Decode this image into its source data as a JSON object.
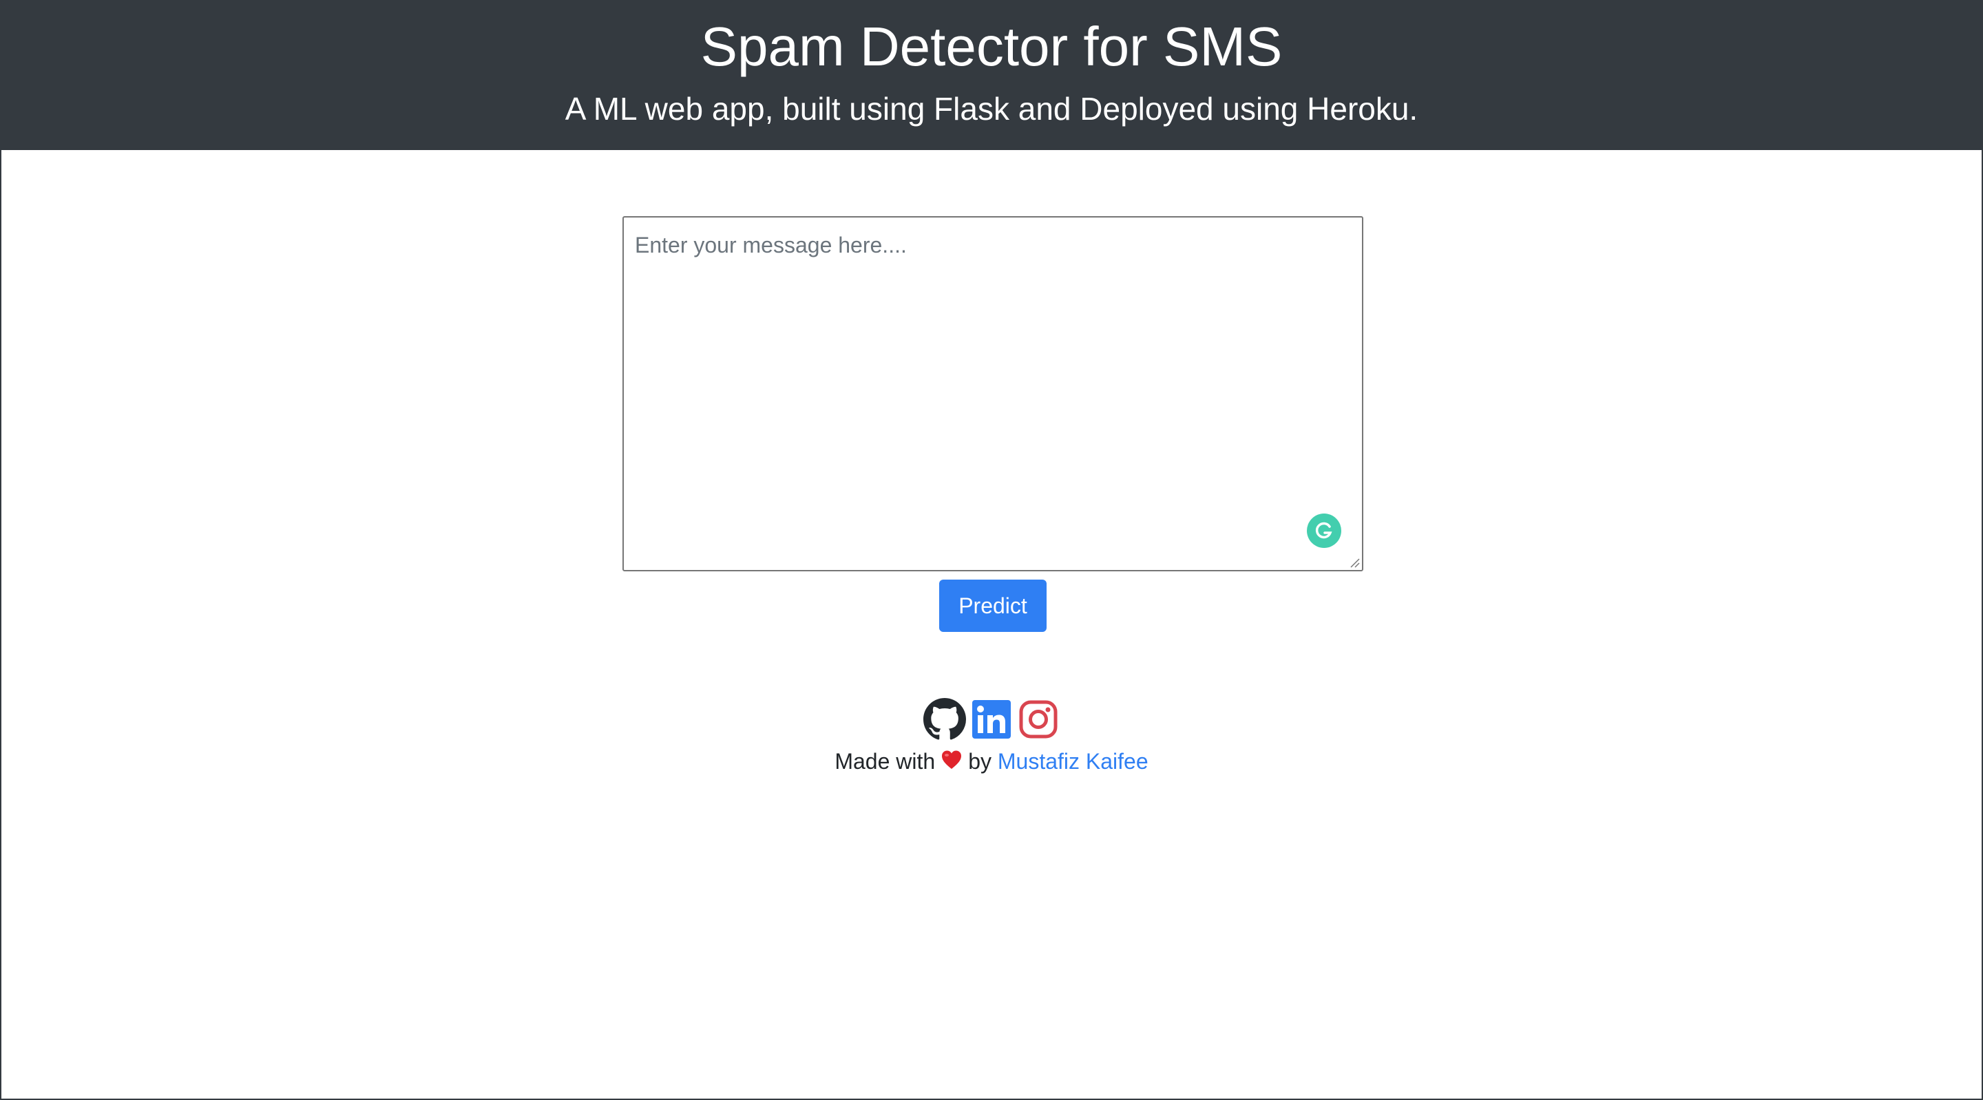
{
  "header": {
    "title": "Spam Detector for SMS",
    "subtitle": "A ML web app, built using Flask and Deployed using Heroku."
  },
  "form": {
    "message_placeholder": "Enter your message here....",
    "message_value": "",
    "predict_label": "Predict",
    "grammarly_icon": "grammarly-icon"
  },
  "social": {
    "items": [
      {
        "name": "github-icon",
        "color": "#24292e"
      },
      {
        "name": "linkedin-icon",
        "color": "#2f7ff3"
      },
      {
        "name": "instagram-icon",
        "color": "#d9454f"
      }
    ]
  },
  "footer": {
    "made_with": "Made with",
    "heart_icon": "heart-icon",
    "by": "by",
    "author": "Mustafiz Kaifee"
  },
  "colors": {
    "header_bg": "#343a40",
    "accent": "#2f7ff3",
    "grammarly": "#15c39a",
    "heart": "#e0242c"
  }
}
